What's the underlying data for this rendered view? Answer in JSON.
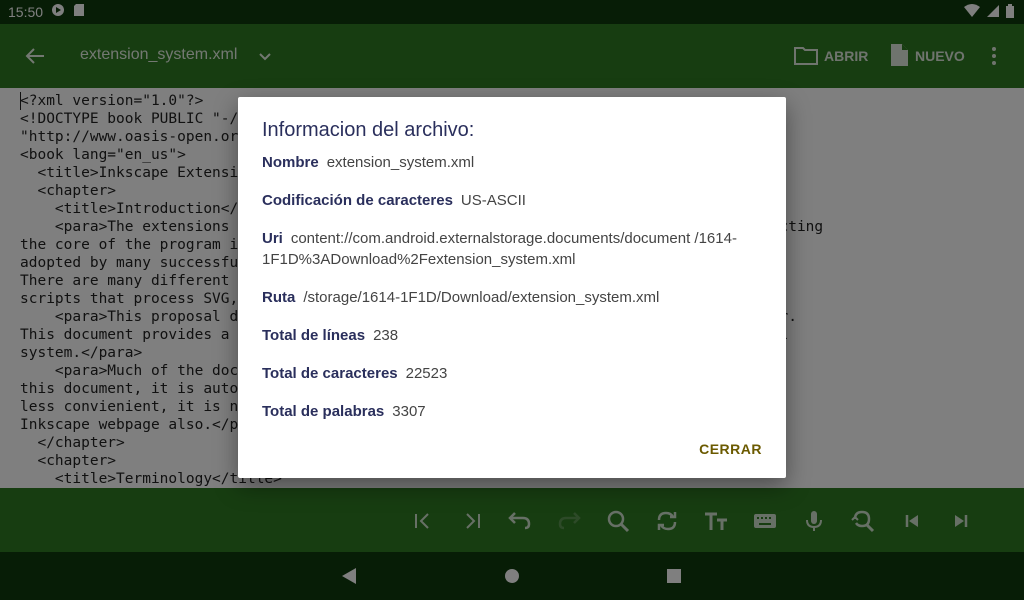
{
  "status_bar": {
    "time": "15:50"
  },
  "toolbar": {
    "title": "extension_system.xml",
    "open_label": "ABRIR",
    "new_label": "NUEVO"
  },
  "editor": {
    "lines": [
      "<?xml version=\"1.0\"?>",
      "<!DOCTYPE book PUBLIC \"-//OASIS//DTD DocBook XML V4.1.2//EN\"",
      "\"http://www.oasis-open.org/docbook/xml/4.1.2/docbookx.dtd\">",
      "<book lang=\"en_us\">",
      "  <title>Inkscape Extensions</title>",
      "  <chapter>",
      "    <title>Introduction</title>",
      "    <para>The extensions system is a way to add functionality to Inkscape, without affecting",
      "the core of the program itself. We want it to follow an approach similar to that",
      "adopted by many successful projects, like the Linux kernel, Apache, Gimp, and so on.",
      "There are many different types of extensions, including file translation tools, filter",
      "scripts that process SVG, and plugins that do effects, and so forth.</para>",
      "    <para>This proposal describes how extensions can be implemented in a flexible manner.",
      "This document provides a description of the system and how it will fit into this overall",
      "system.</para>",
      "    <para>Much of the documentation that is relevant to the system is not included in",
      "this document, it is automatically generated and placed on the webpage.  While this is",
      "less convienient, it is necessary to keep it up to date.  Please look aton the",
      "Inkscape webpage also.</para>",
      "  </chapter>",
      "  <chapter>",
      "    <title>Terminology</title>"
    ]
  },
  "dialog": {
    "title": "Informacion del archivo:",
    "rows": [
      {
        "label": "Nombre",
        "value": "extension_system.xml"
      },
      {
        "label": "Codificación de caracteres",
        "value": "US-ASCII"
      },
      {
        "label": "Uri",
        "value": "content://com.android.externalstorage.documents/document /1614-1F1D%3ADownload%2Fextension_system.xml"
      },
      {
        "label": "Ruta",
        "value": "/storage/1614-1F1D/Download/extension_system.xml"
      },
      {
        "label": "Total de líneas",
        "value": "238"
      },
      {
        "label": "Total de caracteres",
        "value": "22523"
      },
      {
        "label": "Total de palabras",
        "value": "3307"
      }
    ],
    "close_label": "CERRAR"
  },
  "icons": {
    "toolbar": [
      "arrow-back-icon",
      "chevron-down-icon",
      "folder-icon",
      "file-icon",
      "more-vert-icon"
    ],
    "bottom_bar": [
      "first-line-icon",
      "last-line-icon",
      "undo-icon",
      "redo-icon",
      "search-icon",
      "replace-icon",
      "text-size-icon",
      "keyboard-icon",
      "mic-icon",
      "zoom-reset-icon",
      "prev-icon",
      "next-icon"
    ]
  },
  "colors": {
    "status_bar": "#0e3a0c",
    "toolbar": "#2f7a23",
    "dialog_title": "#2a2f5c",
    "close_button": "#6b5a00"
  }
}
